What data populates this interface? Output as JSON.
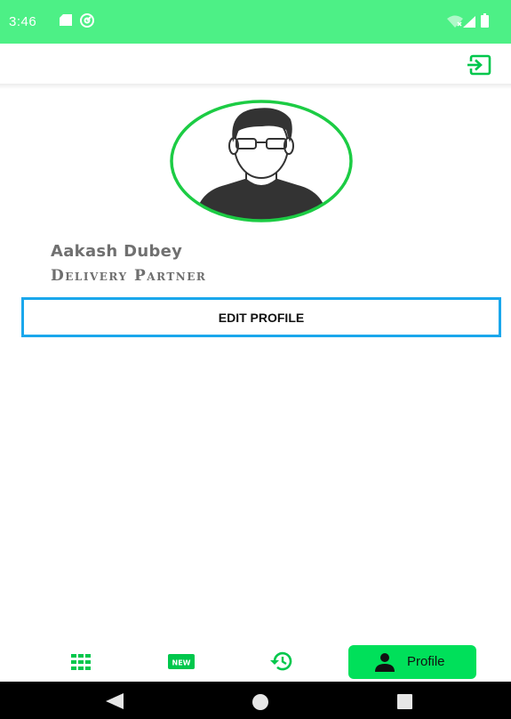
{
  "status_bar": {
    "time": "3:46",
    "icons": [
      "sd-card-icon",
      "gauge-icon",
      "wifi-off-icon",
      "signal-icon",
      "battery-icon"
    ]
  },
  "app_bar": {
    "action_icon": "exit-to-app-icon"
  },
  "profile": {
    "name": "Aakash Dubey",
    "role": "Delivery Partner",
    "avatar_icon": "user-avatar-icon",
    "edit_button_label": "EDIT PROFILE"
  },
  "bottom_nav": {
    "items": [
      {
        "icon": "grid-icon"
      },
      {
        "icon": "new-badge-icon",
        "badge_text": "NEW"
      },
      {
        "icon": "history-icon"
      },
      {
        "icon": "person-icon",
        "label": "Profile",
        "active": true
      }
    ]
  },
  "system_nav": {
    "buttons": [
      "back-icon",
      "home-icon",
      "recents-icon"
    ]
  },
  "colors": {
    "status_bar": "#4df086",
    "accent_green": "#00e05a",
    "avatar_ring": "#1ccc44",
    "button_border": "#1aa7ec",
    "text_gray": "#707070"
  }
}
